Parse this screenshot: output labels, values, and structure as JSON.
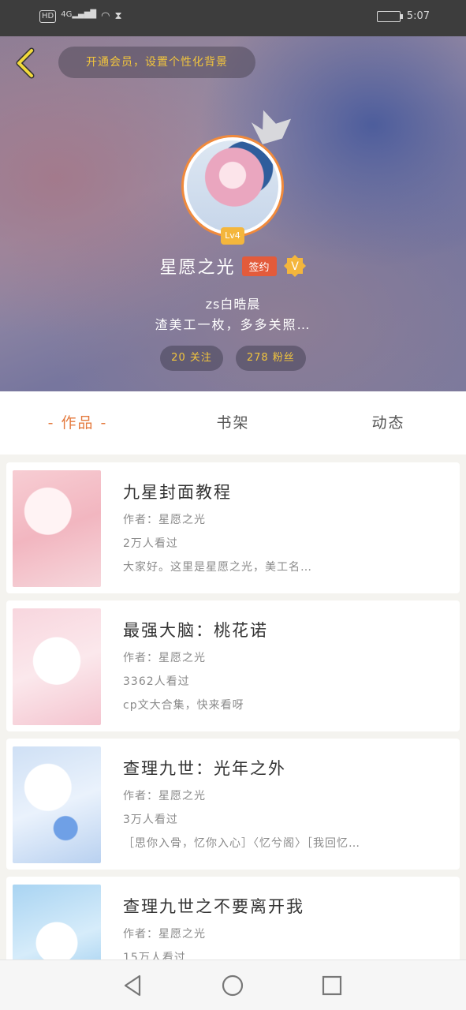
{
  "status_bar": {
    "signal": "4G",
    "hd": "HD",
    "time": "5:07"
  },
  "header": {
    "vip_prompt": "开通会员，设置个性化背景",
    "level": "Lv4",
    "username": "星愿之光",
    "signed_tag": "签约",
    "v_badge": "V",
    "line1": "zs白晧晨",
    "line2": "渣美工一枚，多多关照…",
    "following": "20 关注",
    "fans": "278 粉丝"
  },
  "tabs": [
    {
      "label": "- 作品 -"
    },
    {
      "label": "书架"
    },
    {
      "label": "动态"
    }
  ],
  "works": [
    {
      "title": "九星封面教程",
      "author": "作者：星愿之光",
      "views": "2万人看过",
      "desc": "大家好。这里是星愿之光，美工名…"
    },
    {
      "title": "最强大脑：桃花诺",
      "author": "作者：星愿之光",
      "views": "3362人看过",
      "desc": "cp文大合集，快来看呀"
    },
    {
      "title": "查理九世：光年之外",
      "author": "作者：星愿之光",
      "views": "3万人看过",
      "desc": "［思你入骨，忆你入心］〈忆兮阁〉［我回忆…"
    },
    {
      "title": "查理九世之不要离开我",
      "author": "作者：星愿之光",
      "views": "15万人看过",
      "desc": ""
    }
  ],
  "icons": {
    "back": "back-chevron-icon",
    "crown": "crown-icon",
    "nav_back": "nav-back-icon",
    "nav_home": "nav-home-icon",
    "nav_recent": "nav-recent-icon"
  },
  "colors": {
    "accent": "#e47a3e",
    "gold": "#f2c53d",
    "signed": "#e35b3b"
  }
}
